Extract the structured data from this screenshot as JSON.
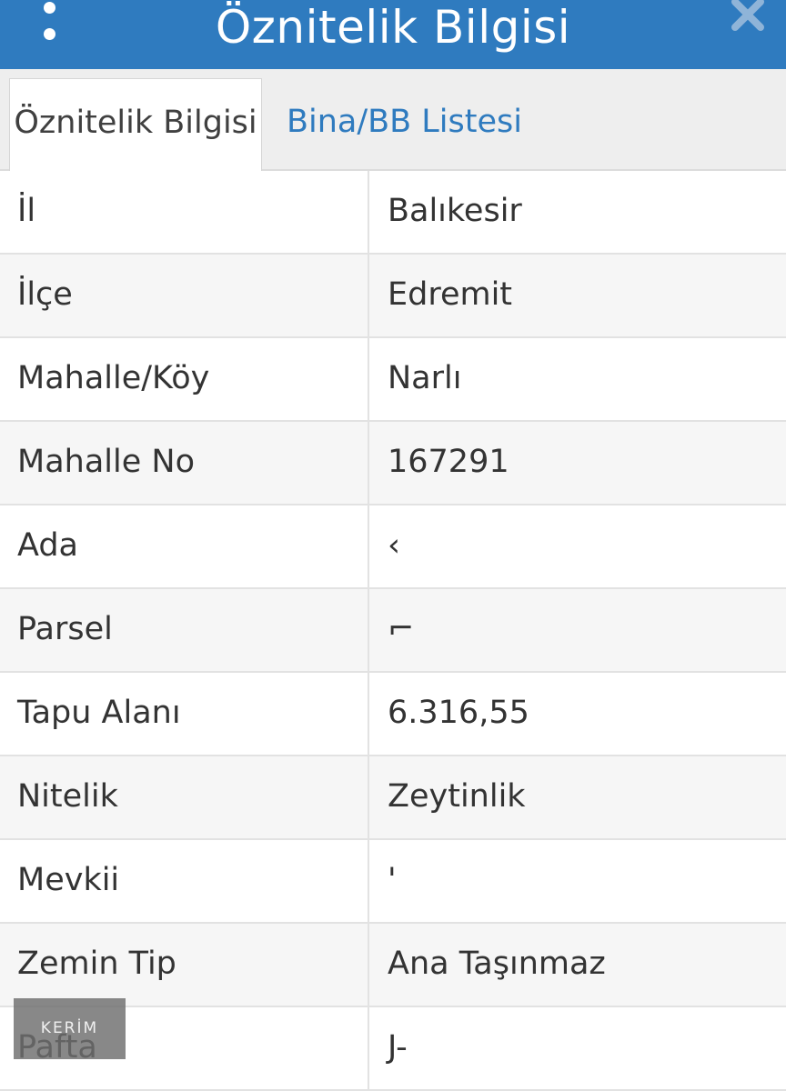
{
  "header": {
    "title": "Öznitelik Bilgisi"
  },
  "tabs": [
    {
      "label": "Öznitelik Bilgisi",
      "active": true
    },
    {
      "label": "Bina/BB Listesi",
      "active": false
    }
  ],
  "attributes": [
    {
      "key": "İl",
      "value": "Balıkesir"
    },
    {
      "key": "İlçe",
      "value": "Edremit"
    },
    {
      "key": "Mahalle/Köy",
      "value": "Narlı"
    },
    {
      "key": "Mahalle No",
      "value": "167291"
    },
    {
      "key": "Ada",
      "value": "‹"
    },
    {
      "key": "Parsel",
      "value": "⌐"
    },
    {
      "key": "Tapu Alanı",
      "value": "6.316,55"
    },
    {
      "key": "Nitelik",
      "value": "Zeytinlik"
    },
    {
      "key": "Mevkii",
      "value": "'"
    },
    {
      "key": "Zemin Tip",
      "value": "Ana Taşınmaz"
    },
    {
      "key": "Pafta",
      "value": "J-"
    }
  ],
  "logo": {
    "text": "KERİM"
  },
  "colors": {
    "header_bg": "#2f7bbf",
    "tab_link": "#2f7bbf"
  }
}
